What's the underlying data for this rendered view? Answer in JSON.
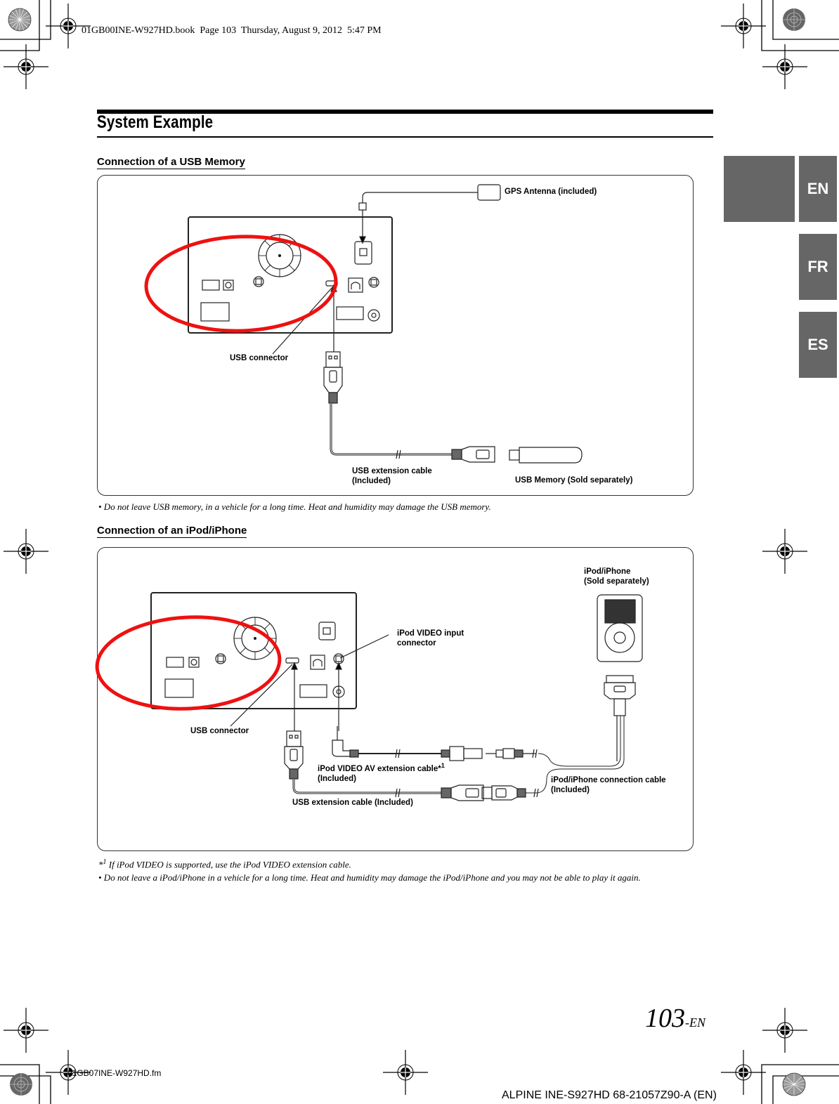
{
  "print_header": {
    "book_info": "01GB00INE-W927HD.book  Page 103  Thursday, August 9, 2012  5:47 PM"
  },
  "page": {
    "title": "System Example",
    "language_tabs": [
      {
        "label": "EN",
        "active": true
      },
      {
        "label": "FR",
        "active": false
      },
      {
        "label": "ES",
        "active": false
      }
    ],
    "tab_color": "#666666",
    "highlight_color": "#ee1111"
  },
  "usb_section": {
    "heading": "Connection of a USB Memory",
    "labels": {
      "gps_antenna": "GPS Antenna (included)",
      "usb_connector": "USB connector",
      "usb_extension_cable": "USB extension cable\n(Included)",
      "usb_memory": "USB Memory (Sold separately)"
    },
    "note": "•   Do not leave USB memory, in a vehicle for a long time. Heat and humidity may damage the USB memory."
  },
  "ipod_section": {
    "heading": "Connection of an iPod/iPhone",
    "labels": {
      "ipod_device": "iPod/iPhone\n(Sold separately)",
      "ipod_video_input": "iPod VIDEO input\nconnector",
      "usb_connector": "USB connector",
      "av_extension_cable": "iPod VIDEO AV extension cable*",
      "av_extension_sup": "1",
      "av_extension_included": "(Included)",
      "ipod_connection_cable": "iPod/iPhone connection cable\n(Included)",
      "usb_extension_cable": "USB extension cable (Included)"
    },
    "footnote_mark": "*",
    "footnote_sup": "1",
    "footnote": " If iPod VIDEO is supported, use the iPod VIDEO extension cable.",
    "note": "•   Do not leave a iPod/iPhone in a vehicle for a long time. Heat and humidity may damage the iPod/iPhone and you may not be able to play it again."
  },
  "footer": {
    "page_number": "103",
    "page_suffix": "-EN",
    "source_file": "01GB07INE-W927HD.fm",
    "model_info": "ALPINE INE-S927HD 68-21057Z90-A (EN)"
  }
}
